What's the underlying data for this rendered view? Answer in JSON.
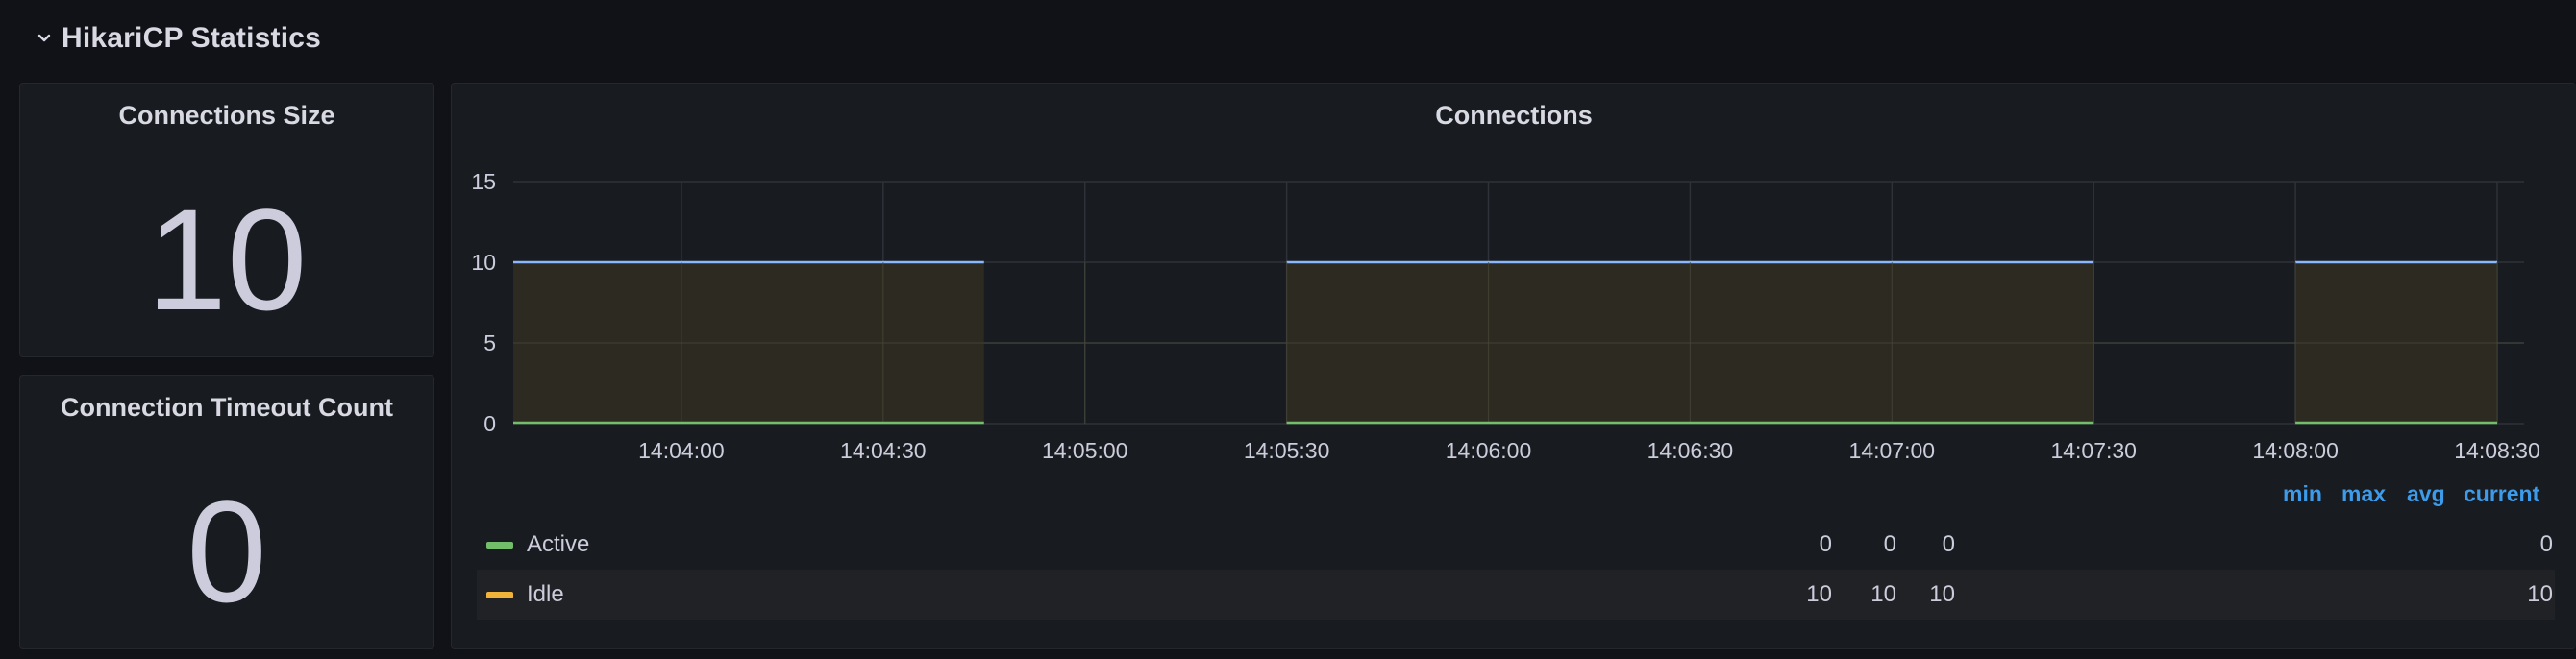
{
  "row": {
    "title": "HikariCP Statistics",
    "collapse_icon": "chevron-down-icon"
  },
  "stats": {
    "connections_size": {
      "title": "Connections Size",
      "value": "10"
    },
    "connection_timeout_count": {
      "title": "Connection Timeout Count",
      "value": "0"
    }
  },
  "connections_panel": {
    "title": "Connections",
    "legend": {
      "headers": [
        "min",
        "max",
        "avg",
        "current"
      ],
      "rows": [
        {
          "name": "Active",
          "color": "#73bf69",
          "min": "0",
          "max": "0",
          "avg": "0",
          "current": "0"
        },
        {
          "name": "Idle",
          "color": "#f2b33a",
          "min": "10",
          "max": "10",
          "avg": "10",
          "current": "10"
        }
      ]
    }
  },
  "colors": {
    "background": "#111217",
    "panel": "#181b1f",
    "idle_line": "#8ab8ff",
    "idle_fill": "#2e2b22",
    "active_line": "#73bf69",
    "legend_header": "#3d9be9"
  },
  "chart_data": {
    "type": "area",
    "title": "Connections",
    "x_ticks": [
      "14:04:00",
      "14:04:30",
      "14:05:00",
      "14:05:30",
      "14:06:00",
      "14:06:30",
      "14:07:00",
      "14:07:30",
      "14:08:00",
      "14:08:30"
    ],
    "y_ticks": [
      0,
      5,
      10,
      15
    ],
    "ylim": [
      0,
      15
    ],
    "xlim": [
      "14:03:35",
      "14:08:34"
    ],
    "grid": true,
    "legend_position": "bottom",
    "series": [
      {
        "name": "Active",
        "color": "#73bf69",
        "segments": [
          {
            "start": "14:03:35",
            "end": "14:04:45",
            "value": 0
          },
          {
            "start": "14:05:30",
            "end": "14:07:30",
            "value": 0
          },
          {
            "start": "14:08:00",
            "end": "14:08:30",
            "value": 0
          }
        ]
      },
      {
        "name": "Idle",
        "color": "#f2b33a",
        "segments": [
          {
            "start": "14:03:35",
            "end": "14:04:45",
            "value": 10
          },
          {
            "start": "14:05:30",
            "end": "14:07:30",
            "value": 10
          },
          {
            "start": "14:08:00",
            "end": "14:08:30",
            "value": 10
          }
        ]
      }
    ]
  }
}
